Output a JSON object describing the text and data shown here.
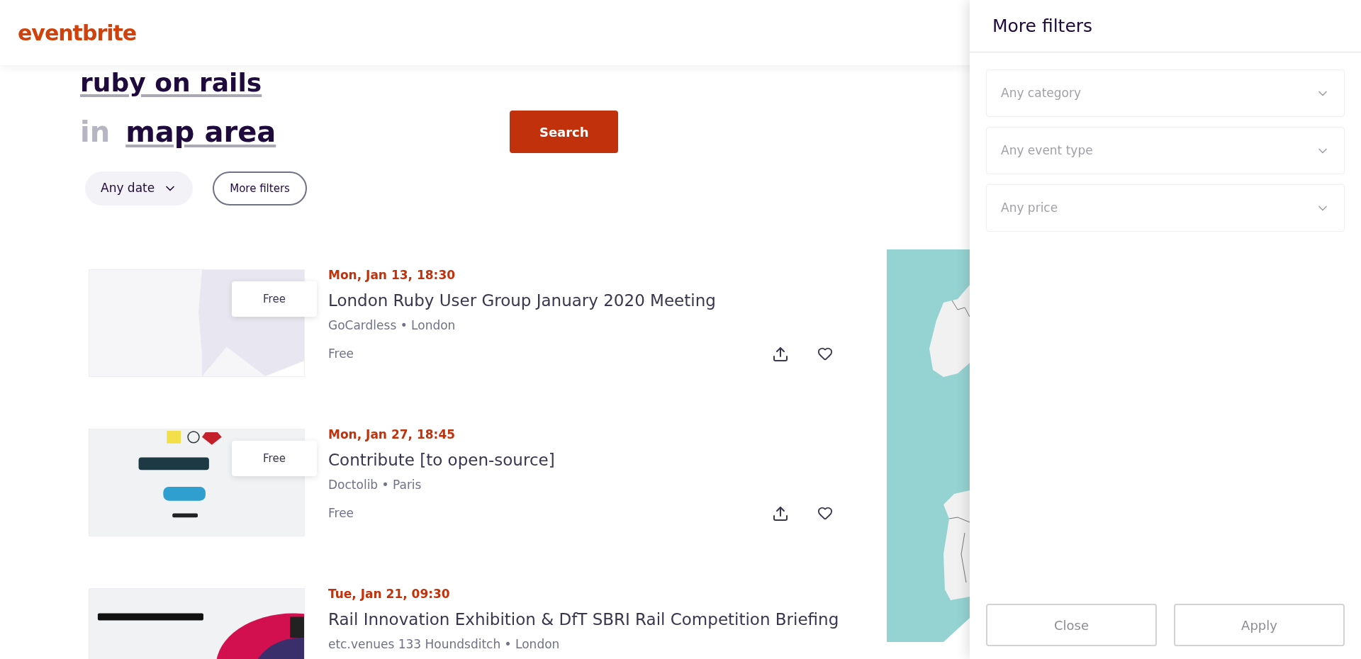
{
  "header": {
    "logo": "eventbrite"
  },
  "search": {
    "query": "ruby on rails",
    "location_prefix": "in",
    "location": "map area",
    "button": "Search"
  },
  "filters": [
    {
      "label": "Any date",
      "kind": "dropdown"
    },
    {
      "label": "More filters",
      "kind": "outline"
    }
  ],
  "events": [
    {
      "date": "Mon, Jan 13, 18:30",
      "title": "London Ruby User Group January 2020 Meeting",
      "venue": "GoCardless • London",
      "price": "Free",
      "badge": "Free"
    },
    {
      "date": "Mon, Jan 27, 18:45",
      "title": "Contribute [to open-source]",
      "venue": "Doctolib • Paris",
      "price": "Free",
      "badge": "Free"
    },
    {
      "date": "Tue, Jan 21, 09:30",
      "title": "Rail Innovation Exhibition & DfT SBRI Rail Competition Briefing",
      "venue": "etc.venues 133 Houndsditch • London"
    }
  ],
  "panel": {
    "title": "More filters",
    "selects": [
      {
        "placeholder": "Any category"
      },
      {
        "placeholder": "Any event type"
      },
      {
        "placeholder": "Any price"
      }
    ],
    "buttons": [
      "Close",
      "Apply"
    ]
  }
}
